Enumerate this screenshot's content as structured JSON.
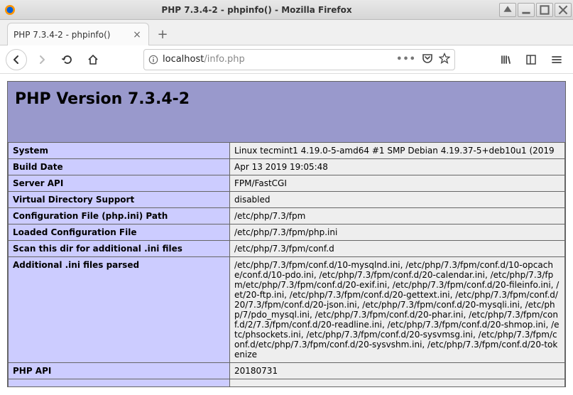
{
  "window": {
    "title": "PHP 7.3.4-2 - phpinfo() - Mozilla Firefox"
  },
  "tab": {
    "label": "PHP 7.3.4-2 - phpinfo()"
  },
  "url": {
    "host": "localhost",
    "path": "/info.php"
  },
  "phpinfo": {
    "heading": "PHP Version 7.3.4-2",
    "rows": [
      {
        "k": "System",
        "v": "Linux tecmint1 4.19.0-5-amd64 #1 SMP Debian 4.19.37-5+deb10u1 (2019"
      },
      {
        "k": "Build Date",
        "v": "Apr 13 2019 19:05:48"
      },
      {
        "k": "Server API",
        "v": "FPM/FastCGI"
      },
      {
        "k": "Virtual Directory Support",
        "v": "disabled"
      },
      {
        "k": "Configuration File (php.ini) Path",
        "v": "/etc/php/7.3/fpm"
      },
      {
        "k": "Loaded Configuration File",
        "v": "/etc/php/7.3/fpm/php.ini"
      },
      {
        "k": "Scan this dir for additional .ini files",
        "v": "/etc/php/7.3/fpm/conf.d"
      },
      {
        "k": "Additional .ini files parsed",
        "v": "/etc/php/7.3/fpm/conf.d/10-mysqlnd.ini, /etc/php/7.3/fpm/conf.d/10-opcache/conf.d/10-pdo.ini, /etc/php/7.3/fpm/conf.d/20-calendar.ini, /etc/php/7.3/fpm/etc/php/7.3/fpm/conf.d/20-exif.ini, /etc/php/7.3/fpm/conf.d/20-fileinfo.ini, /et/20-ftp.ini, /etc/php/7.3/fpm/conf.d/20-gettext.ini, /etc/php/7.3/fpm/conf.d/20/7.3/fpm/conf.d/20-json.ini, /etc/php/7.3/fpm/conf.d/20-mysqli.ini, /etc/php/7/pdo_mysql.ini, /etc/php/7.3/fpm/conf.d/20-phar.ini, /etc/php/7.3/fpm/conf.d/2/7.3/fpm/conf.d/20-readline.ini, /etc/php/7.3/fpm/conf.d/20-shmop.ini, /etc/phsockets.ini, /etc/php/7.3/fpm/conf.d/20-sysvmsg.ini, /etc/php/7.3/fpm/conf.d/etc/php/7.3/fpm/conf.d/20-sysvshm.ini, /etc/php/7.3/fpm/conf.d/20-tokenize"
      },
      {
        "k": "PHP API",
        "v": "20180731"
      }
    ]
  }
}
